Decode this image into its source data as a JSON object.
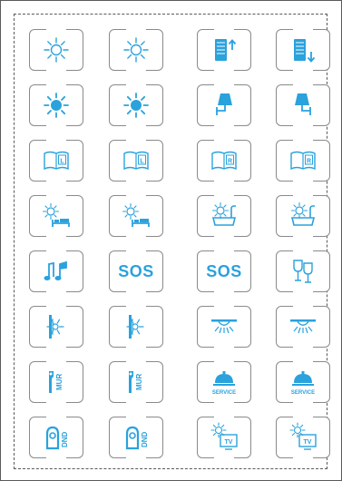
{
  "accent_color": "#2aa2dc",
  "border_color": "#8a8a8a",
  "keys": [
    [
      {
        "icon": "sun-outline-icon"
      },
      {
        "icon": "sun-outline-icon"
      },
      {
        "icon": "blind-up-icon"
      },
      {
        "icon": "blind-down-icon"
      }
    ],
    [
      {
        "icon": "sun-filled-icon"
      },
      {
        "icon": "sun-filled-icon"
      },
      {
        "icon": "wall-lamp-left-icon"
      },
      {
        "icon": "wall-lamp-right-icon"
      }
    ],
    [
      {
        "icon": "reading-light-left-icon",
        "glyph": "L"
      },
      {
        "icon": "reading-light-left-icon",
        "glyph": "L"
      },
      {
        "icon": "reading-light-right-icon",
        "glyph": "R"
      },
      {
        "icon": "reading-light-right-icon",
        "glyph": "R"
      }
    ],
    [
      {
        "icon": "bed-light-icon"
      },
      {
        "icon": "bed-light-icon"
      },
      {
        "icon": "bath-light-icon"
      },
      {
        "icon": "bath-light-icon"
      }
    ],
    [
      {
        "icon": "music-icon"
      },
      {
        "icon": "sos-text",
        "text": "SOS"
      },
      {
        "icon": "sos-text",
        "text": "SOS"
      },
      {
        "icon": "wine-glasses-icon"
      }
    ],
    [
      {
        "icon": "wall-washer-icon"
      },
      {
        "icon": "wall-washer-icon"
      },
      {
        "icon": "ceiling-light-icon"
      },
      {
        "icon": "ceiling-light-icon"
      }
    ],
    [
      {
        "icon": "make-up-room-icon",
        "text": "MUR"
      },
      {
        "icon": "make-up-room-icon",
        "text": "MUR"
      },
      {
        "icon": "room-service-icon",
        "text": "SERVICE"
      },
      {
        "icon": "room-service-icon",
        "text": "SERVICE"
      }
    ],
    [
      {
        "icon": "do-not-disturb-icon",
        "text": "DND"
      },
      {
        "icon": "do-not-disturb-icon",
        "text": "DND"
      },
      {
        "icon": "tv-light-icon",
        "text": "TV"
      },
      {
        "icon": "tv-light-icon",
        "text": "TV"
      }
    ]
  ]
}
